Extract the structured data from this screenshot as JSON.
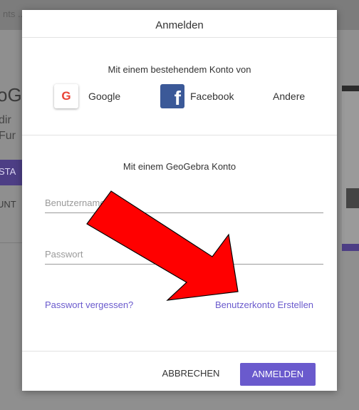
{
  "background": {
    "topbar_text": "nts  ...  ii  ...",
    "title": "oG",
    "sub1": "dir",
    "sub2": "Fur",
    "button1": "STA",
    "button2": "UNT"
  },
  "dialog": {
    "title": "Anmelden",
    "existing_account_label": "Mit einem bestehendem Konto von",
    "providers": {
      "google_label": "Google",
      "google_icon": "G",
      "facebook_label": "Facebook",
      "facebook_icon": "f",
      "other_label": "Andere"
    },
    "geogebra_label": "Mit einem GeoGebra Konto",
    "username_placeholder": "Benutzername",
    "password_placeholder": "Passwort",
    "forgot_password": "Passwort vergessen?",
    "create_account": "Benutzerkonto Erstellen",
    "cancel": "ABBRECHEN",
    "login": "ANMELDEN"
  },
  "colors": {
    "accent": "#6a5acd",
    "facebook": "#3b5998",
    "annotation_arrow": "#ff0000"
  }
}
